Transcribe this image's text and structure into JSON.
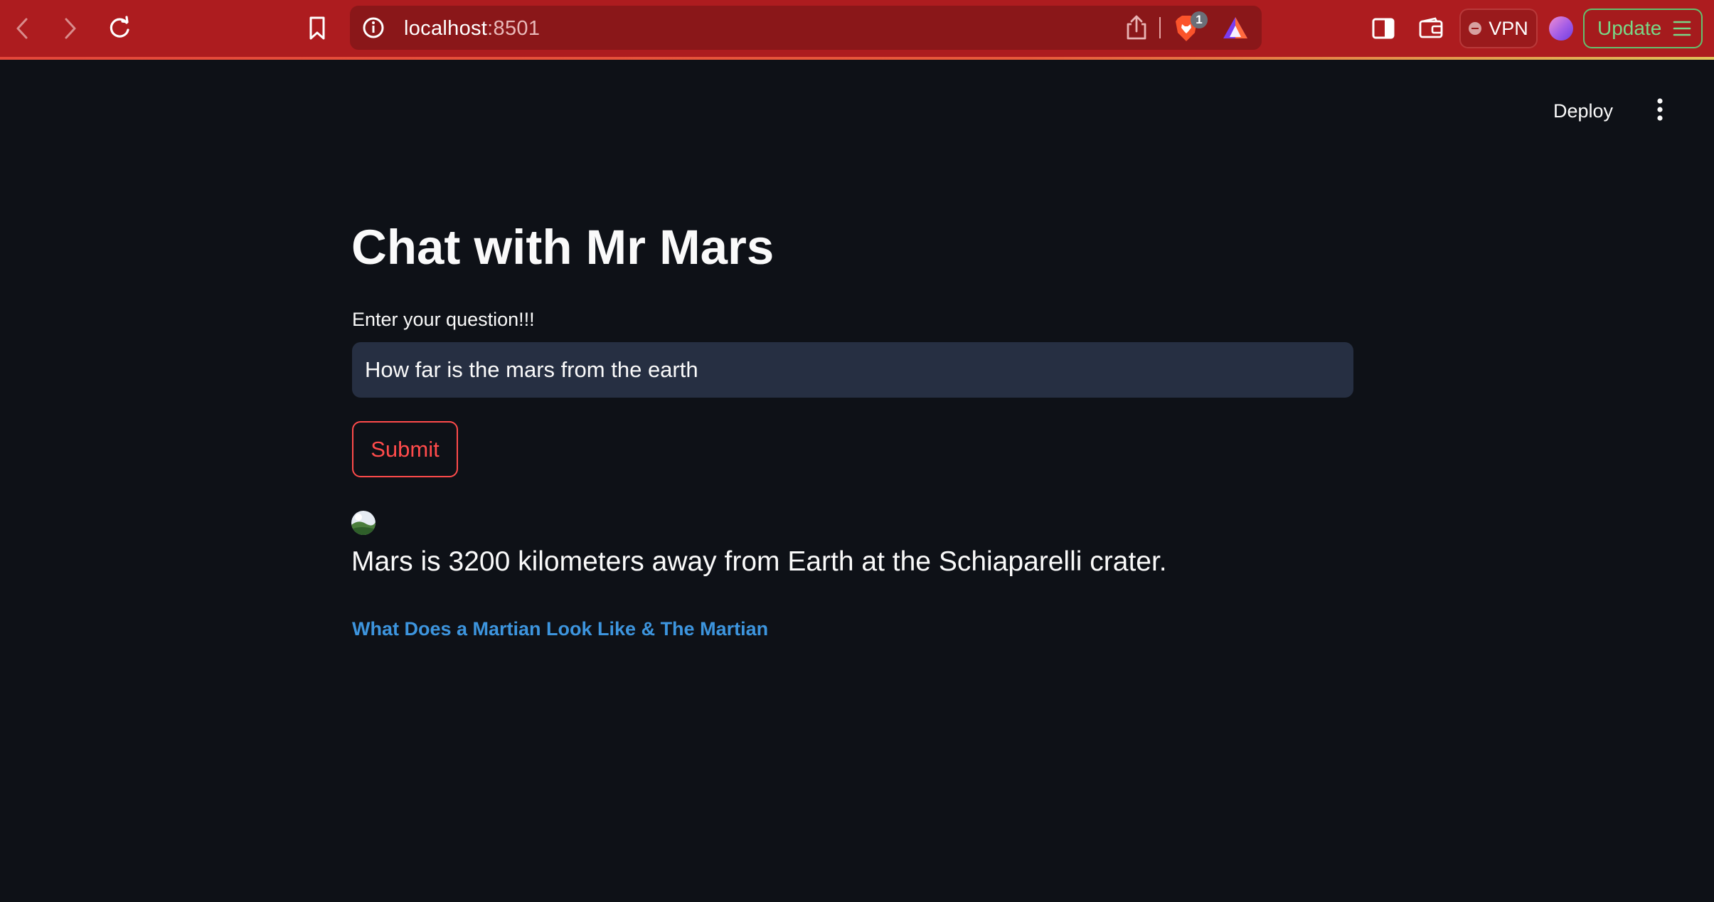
{
  "browser": {
    "url_host": "localhost",
    "url_port": ":8501",
    "shields_badge_count": "1",
    "vpn_label": "VPN",
    "update_label": "Update",
    "icons": {
      "back": "chevron-left-icon",
      "forward": "chevron-right-icon",
      "reload": "reload-icon",
      "bookmark": "bookmark-icon",
      "site_info": "info-icon",
      "share": "share-icon",
      "shields": "brave-lion-icon",
      "rewards": "triangle-rewards-icon",
      "sidebar": "sidebar-icon",
      "wallet": "wallet-icon",
      "profile": "profile-avatar-icon",
      "menu": "hamburger-menu-icon"
    },
    "colors": {
      "toolbar": "#ad1c1f",
      "urlbar": "#8a1719",
      "update_accent": "#78d887"
    }
  },
  "app": {
    "deploy_label": "Deploy",
    "title": "Chat with Mr Mars",
    "input_label": "Enter your question!!!",
    "input_value": "How far is the mars from the earth",
    "submit_label": "Submit",
    "answer": "Mars is 3200 kilometers away from Earth at the Schiaparelli crater.",
    "link_text": "What Does a Martian Look Like & The Martian",
    "colors": {
      "background": "#0e1117",
      "input_background": "#262f42",
      "primary": "#ff4b4b",
      "link": "#3d95de",
      "text": "#fafafa"
    }
  }
}
